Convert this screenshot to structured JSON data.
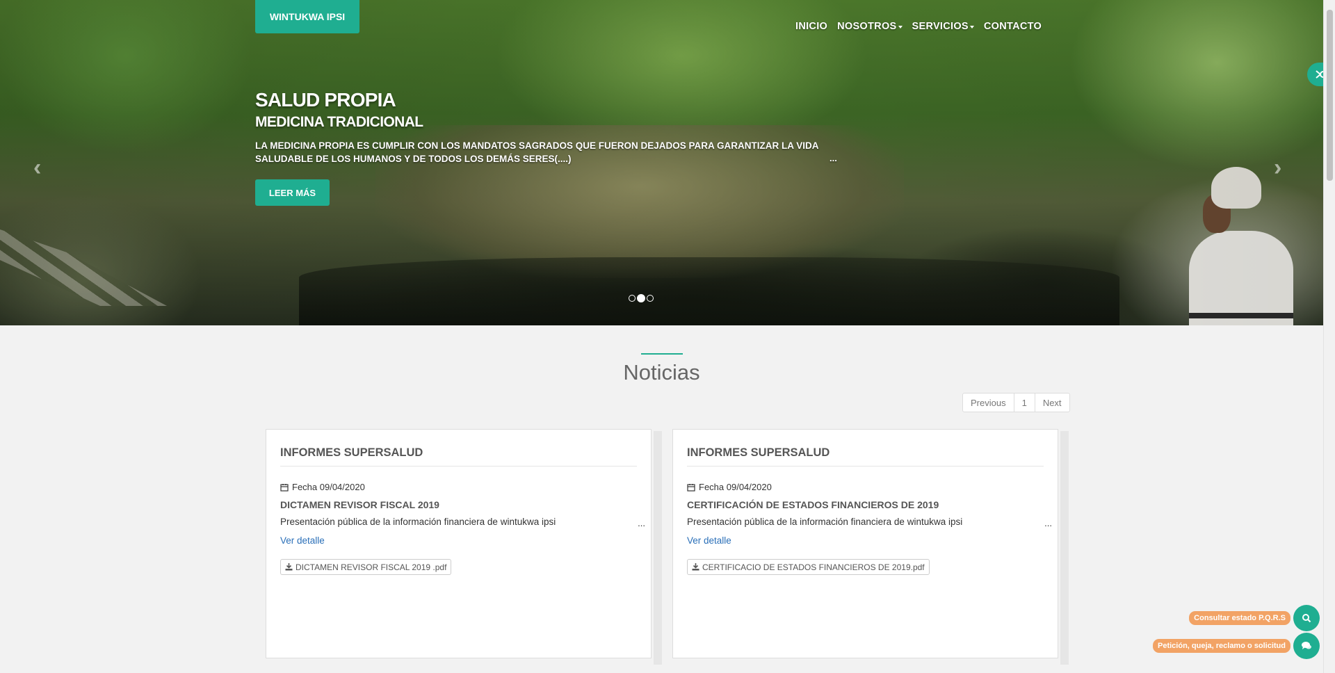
{
  "header": {
    "brand": "WINTUKWA IPSI",
    "nav": [
      {
        "label": "INICIO"
      },
      {
        "label": "NOSOTROS"
      },
      {
        "label": "SERVICIOS"
      },
      {
        "label": "CONTACTO"
      }
    ]
  },
  "hero": {
    "title": "SALUD PROPIA",
    "subtitle": "MEDICINA TRADICIONAL",
    "description": "LA MEDICINA PROPIA ES CUMPLIR CON LOS MANDATOS SAGRADOS QUE FUERON DEJADOS PARA GARANTIZAR LA VIDA SALUDABLE DE LOS HUMANOS Y DE TODOS LOS DEMÁS SERES(....)",
    "ellipsis": "...",
    "button_label": "LEER MÁS",
    "slides_total": 3,
    "active_slide": 2
  },
  "news": {
    "section_title": "Noticias",
    "pagination": {
      "previous": "Previous",
      "page": "1",
      "next": "Next"
    },
    "cards": [
      {
        "category": "INFORMES SUPERSALUD",
        "date": "Fecha 09/04/2020",
        "title": "DICTAMEN REVISOR FISCAL 2019",
        "summary": "Presentación pública de la información financiera de wintukwa ipsi",
        "ellipsis": "...",
        "link": "Ver detalle",
        "attachment": "DICTAMEN REVISOR FISCAL 2019 .pdf"
      },
      {
        "category": "INFORMES SUPERSALUD",
        "date": "Fecha 09/04/2020",
        "title": "CERTIFICACIÓN DE ESTADOS FINANCIEROS DE 2019",
        "summary": "Presentación pública de la información financiera de wintukwa ipsi",
        "ellipsis": "...",
        "link": "Ver detalle",
        "attachment": "CERTIFICACIO DE ESTADOS FINANCIEROS DE 2019.pdf"
      }
    ]
  },
  "floating": {
    "consult": "Consultar estado P.Q.R.S",
    "request": "Petición, queja, reclamo o solicitud"
  },
  "colors": {
    "accent": "#1fae91",
    "orange": "#f2a365",
    "link": "#2a6fb8"
  }
}
